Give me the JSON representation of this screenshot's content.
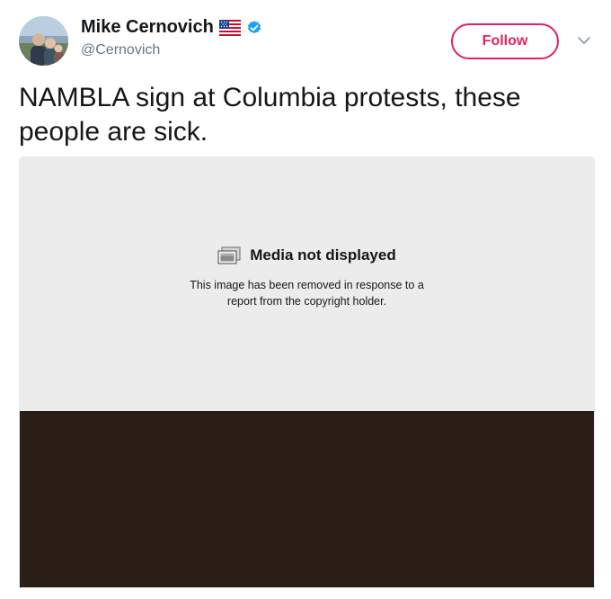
{
  "author": {
    "display_name": "Mike Cernovich",
    "handle": "@Cernovich",
    "flag_icon": "us-flag-icon",
    "verified_icon": "verified-badge-icon"
  },
  "actions": {
    "follow_label": "Follow",
    "menu_icon": "chevron-down-icon"
  },
  "tweet": {
    "text": "NAMBLA sign at Columbia protests, these people are sick."
  },
  "media": {
    "icon": "media-image-icon",
    "notice_title": "Media not displayed",
    "notice_line1": "This image has been removed in response to a",
    "notice_line2": "report from the copyright holder."
  },
  "colors": {
    "follow_accent": "#e0245e",
    "verified_blue": "#1da1f2",
    "placeholder_bg": "#ececec",
    "dark_area": "#2b1e17",
    "handle_gray": "#657786"
  }
}
